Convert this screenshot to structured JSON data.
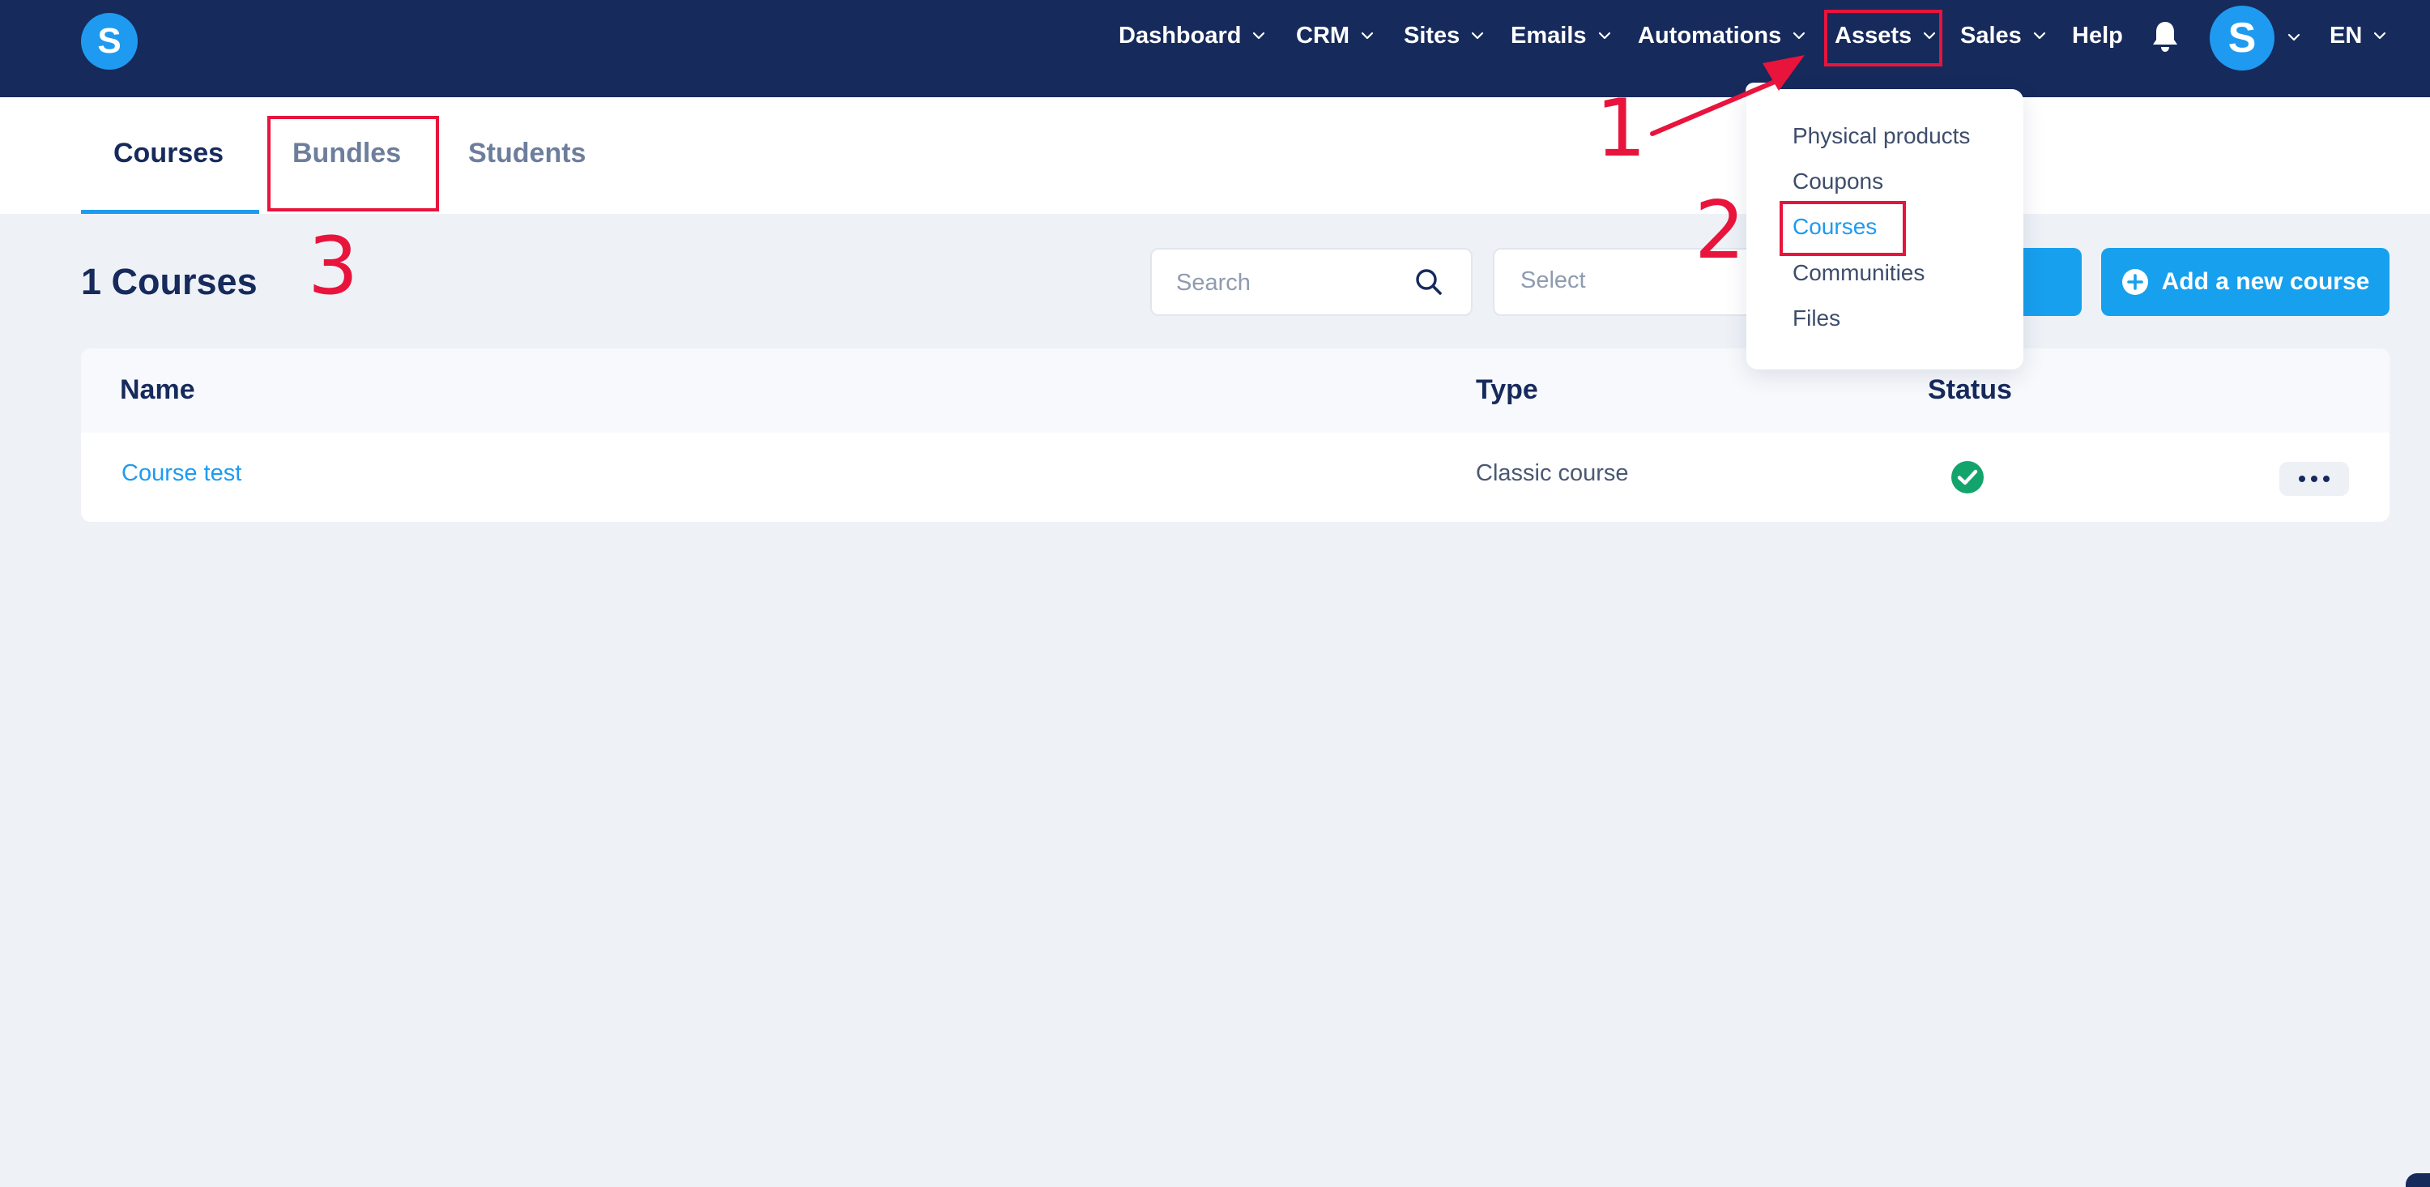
{
  "app": {
    "logo_letter": "S"
  },
  "nav": {
    "items": [
      {
        "label": "Dashboard"
      },
      {
        "label": "CRM"
      },
      {
        "label": "Sites"
      },
      {
        "label": "Emails"
      },
      {
        "label": "Automations"
      },
      {
        "label": "Assets"
      },
      {
        "label": "Sales"
      },
      {
        "label": "Help"
      }
    ],
    "avatar_letter": "S",
    "language": "EN"
  },
  "tabs": [
    {
      "label": "Courses",
      "active": true
    },
    {
      "label": "Bundles",
      "active": false
    },
    {
      "label": "Students",
      "active": false
    }
  ],
  "header": {
    "title": "1 Courses",
    "search_placeholder": "Search",
    "select_value": "Select",
    "add_button_label": "Add a new course"
  },
  "table": {
    "columns": [
      "Name",
      "Type",
      "Status"
    ],
    "rows": [
      {
        "name": "Course test",
        "type": "Classic course",
        "status": "active"
      }
    ]
  },
  "assets_menu": {
    "items": [
      {
        "label": "Physical products"
      },
      {
        "label": "Coupons"
      },
      {
        "label": "Courses",
        "active": true
      },
      {
        "label": "Communities"
      },
      {
        "label": "Files"
      }
    ]
  },
  "annotations": {
    "step1": "1",
    "step2": "2",
    "step3": "3"
  },
  "colors": {
    "navbar": "#162a5c",
    "accent": "#1e9bf0",
    "annotation": "#e8143c",
    "success": "#13a46b",
    "background": "#eef2f7"
  }
}
